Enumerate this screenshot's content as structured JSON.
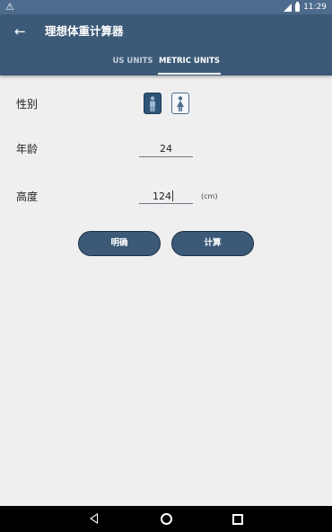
{
  "status_bar": {
    "time": "11:29"
  },
  "header": {
    "title": "理想体重计算器"
  },
  "tabs": [
    {
      "label": "US UNITS"
    },
    {
      "label": "METRIC UNITS"
    }
  ],
  "form": {
    "gender_label": "性别",
    "age_label": "年龄",
    "age_value": "24",
    "height_label": "高度",
    "height_value": "124",
    "height_unit": "(cm)"
  },
  "buttons": {
    "clear": "明确",
    "calculate": "计算"
  },
  "colors": {
    "status_bar": "#4d6c8d",
    "app_bar": "#3c5a78",
    "button": "#3c5a78",
    "background": "#efefef"
  }
}
